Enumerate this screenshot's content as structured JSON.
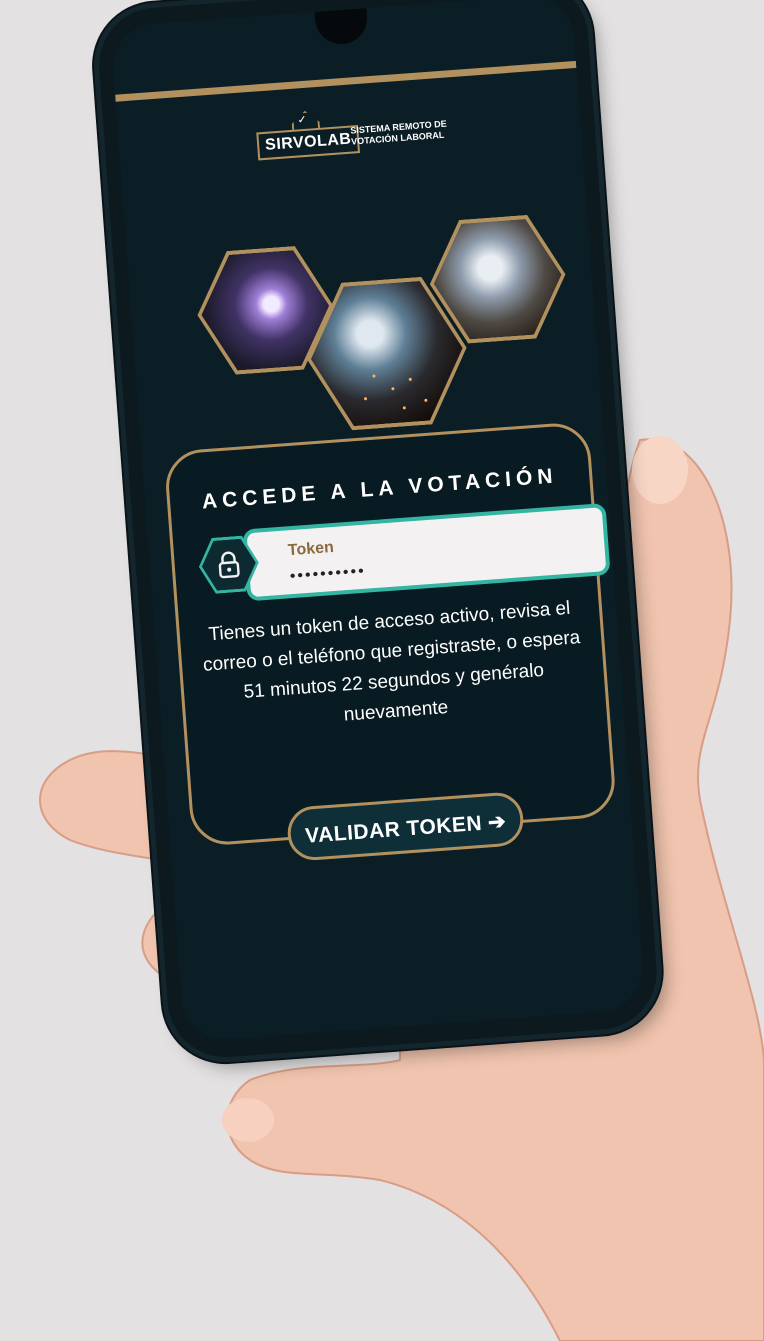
{
  "brand": {
    "name": "SIRVOLAB",
    "tagline_line1": "SISTEMA REMOTO DE",
    "tagline_line2": "VOTACIÓN LABORAL"
  },
  "login_card": {
    "title": "ACCEDE A LA VOTACIÓN",
    "token_label": "Token",
    "token_value": "••••••••••",
    "message": "Tienes un token de acceso activo, revisa el correo o el teléfono que registraste, o espera 51 minutos 22 segundos y genéralo nuevamente",
    "submit_label": "VALIDAR TOKEN",
    "submit_arrow": "➔"
  },
  "icons": {
    "lock": "lock-icon",
    "check": "checkmark-icon",
    "arrow": "arrow-right-icon"
  },
  "colors": {
    "background": "#0b1e26",
    "accent_gold": "#b2915e",
    "accent_teal": "#33b5a2",
    "input_bg": "#f4f1f3"
  }
}
